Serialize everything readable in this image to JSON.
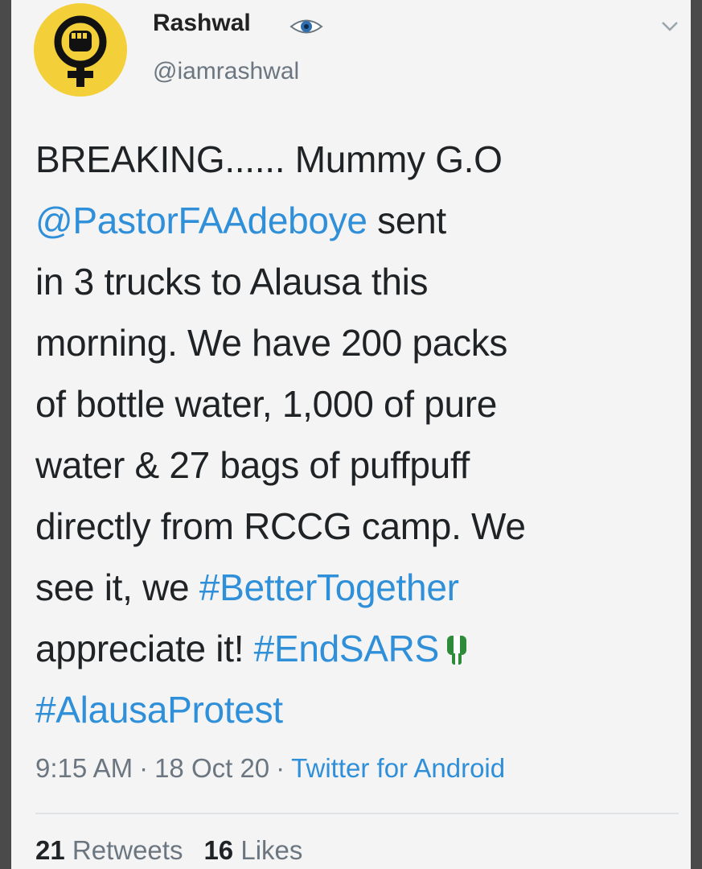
{
  "tweet": {
    "author": {
      "display_name": "Rashwal",
      "handle": "@iamrashwal",
      "avatar_icon": "venus-fist-icon",
      "avatar_color": "#f3cf3a",
      "badge_icon": "eye-icon"
    },
    "menu_icon": "chevron-down-icon",
    "body": {
      "l1": "BREAKING...... Mummy G.O",
      "l2_mention": "@PastorFAAdeboye",
      "l2_text": " sent",
      "l3": "in 3 trucks to Alausa this",
      "l4": "morning. We have 200 packs",
      "l5": "of bottle water, 1,000 of pure",
      "l6": "water & 27 bags of puffpuff",
      "l7": "directly from RCCG camp. We",
      "l8_text": "see it, we ",
      "l8_hashtag": "#BetterTogether",
      "l9_text": "appreciate it! ",
      "l9_hashtag": "#EndSARS",
      "l9_emoji": "green-white-fist-icon",
      "l10_hashtag": "#AlausaProtest"
    },
    "meta": {
      "time": "9:15 AM",
      "date": "18 Oct 20",
      "separator": "·",
      "source": "Twitter for Android"
    },
    "stats": {
      "retweets_count": "21",
      "retweets_label": "Retweets",
      "likes_count": "16",
      "likes_label": "Likes"
    },
    "colors": {
      "link": "#2f8fd8",
      "text": "#1f2326",
      "muted": "#6b7680"
    }
  }
}
